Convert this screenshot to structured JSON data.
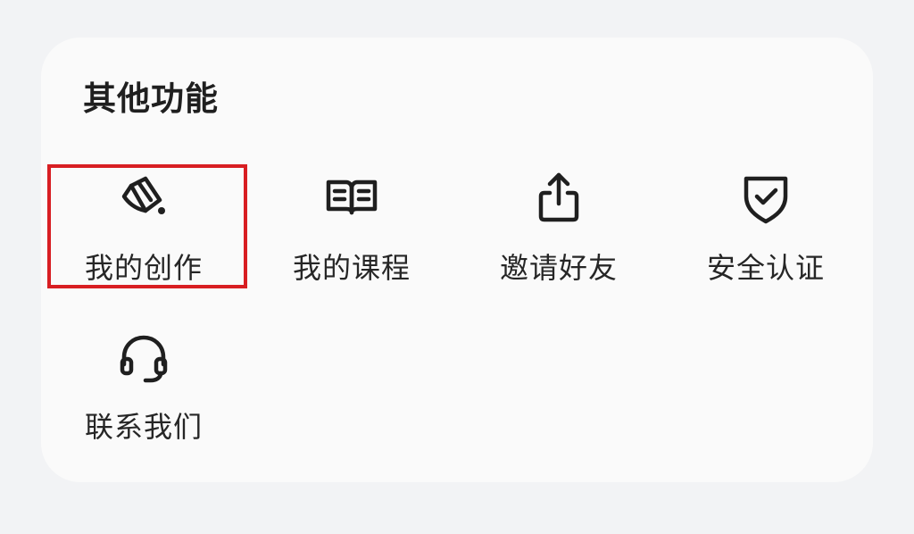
{
  "section": {
    "title": "其他功能"
  },
  "items": [
    {
      "label": "我的创作",
      "icon": "paint-bucket-icon"
    },
    {
      "label": "我的课程",
      "icon": "open-book-icon"
    },
    {
      "label": "邀请好友",
      "icon": "share-icon"
    },
    {
      "label": "安全认证",
      "icon": "shield-check-icon"
    },
    {
      "label": "联系我们",
      "icon": "headset-icon"
    }
  ],
  "highlight": {
    "target": "我的创作",
    "color": "#d81e22"
  },
  "colors": {
    "background": "#f2f3f5",
    "card": "#fafafa",
    "text": "#262626",
    "icon": "#1f1f1f"
  }
}
